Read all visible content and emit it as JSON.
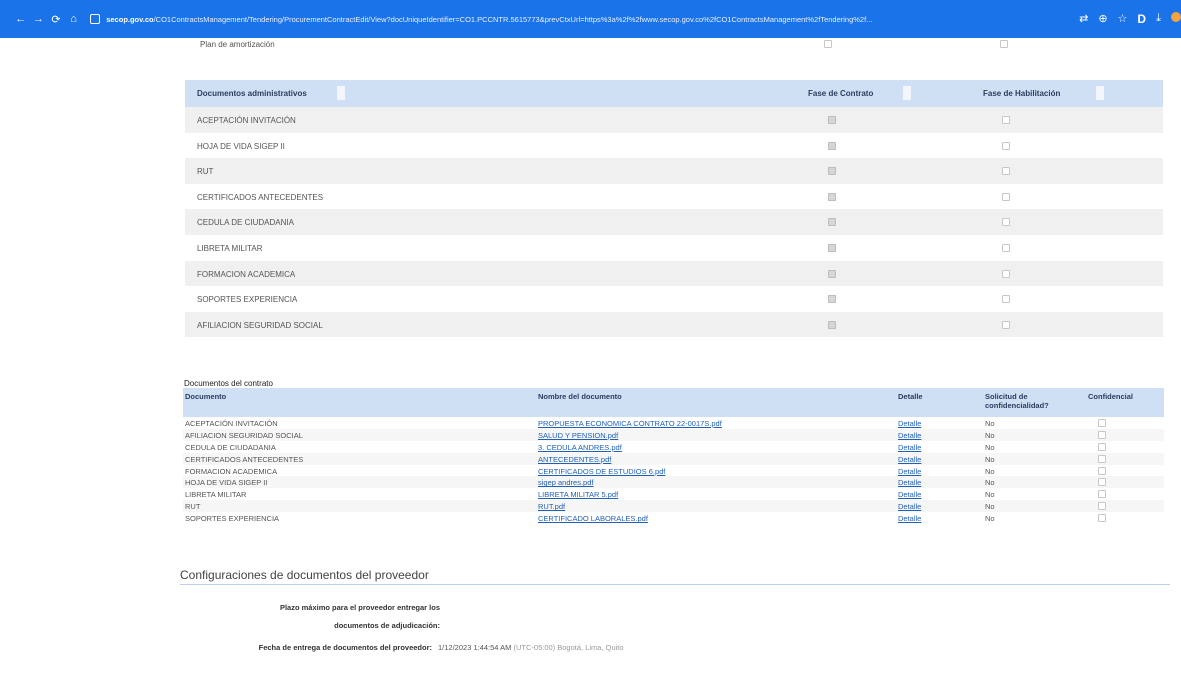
{
  "browser": {
    "back": "←",
    "forward": "→",
    "reload": "⟳",
    "home": "⌂",
    "url_domain": "secop.gov.co",
    "url_path": "/CO1ContractsManagement/Tendering/ProcurementContractEdit/View?docUniqueIdentifier=CO1.PCCNTR.5615773&prevCtxUrl=https%3a%2f%2fwww.secop.gov.co%2fCO1ContractsManagement%2fTendering%2f..."
  },
  "top_row": {
    "label": "Plan de amortización"
  },
  "admin_docs": {
    "headers": [
      "Documentos administrativos",
      "Fase de Contrato",
      "Fase de Habilitación"
    ],
    "rows": [
      "ACEPTACIÓN INVITACIÓN",
      "HOJA DE VIDA SIGEP II",
      "RUT",
      "CERTIFICADOS ANTECEDENTES",
      "CEDULA DE CIUDADANIA",
      "LIBRETA MILITAR",
      "FORMACION ACADEMICA",
      "SOPORTES EXPERIENCIA",
      "AFILIACION SEGURIDAD SOCIAL"
    ]
  },
  "contract_docs": {
    "title": "Documentos del contrato",
    "headers": {
      "document": "Documento",
      "name": "Nombre del documento",
      "detail": "Detalle",
      "request": "Solicitud de confidencialidad?",
      "confidential": "Confidencial"
    },
    "rows": [
      {
        "doc": "ACEPTACIÓN INVITACIÓN",
        "file": "PROPUESTA ECONOMICA CONTRATO 22-0017S.pdf",
        "detail": "Detalle",
        "request": "No"
      },
      {
        "doc": "AFILIACION SEGURIDAD SOCIAL",
        "file": "SALUD Y PENSION.pdf",
        "detail": "Detalle",
        "request": "No"
      },
      {
        "doc": "CEDULA DE CIUDADANIA",
        "file": "3. CEDULA ANDRES.pdf",
        "detail": "Detalle",
        "request": "No"
      },
      {
        "doc": "CERTIFICADOS ANTECEDENTES",
        "file": "ANTECEDENTES.pdf",
        "detail": "Detalle",
        "request": "No"
      },
      {
        "doc": "FORMACION ACADEMICA",
        "file": "CERTIFICADOS DE ESTUDIOS 6.pdf",
        "detail": "Detalle",
        "request": "No"
      },
      {
        "doc": "HOJA DE VIDA SIGEP II",
        "file": "sigep andres.pdf",
        "detail": "Detalle",
        "request": "No"
      },
      {
        "doc": "LIBRETA MILITAR",
        "file": "LIBRETA MILITAR 5.pdf",
        "detail": "Detalle",
        "request": "No"
      },
      {
        "doc": "RUT",
        "file": "RUT.pdf",
        "detail": "Detalle",
        "request": "No"
      },
      {
        "doc": "SOPORTES EXPERIENCIA",
        "file": "CERTIFICADO LABORALES.pdf",
        "detail": "Detalle",
        "request": "No"
      }
    ]
  },
  "config": {
    "title": "Configuraciones de documentos del proveedor",
    "deadline_label_1": "Plazo máximo para el proveedor entregar los",
    "deadline_label_2": "documentos de adjudicación:",
    "delivery_label": "Fecha de entrega de documentos del proveedor:",
    "delivery_value": "1/12/2023 1:44:54 AM",
    "delivery_tz": "(UTC-05:00) Bogotá, Lima, Quito"
  }
}
